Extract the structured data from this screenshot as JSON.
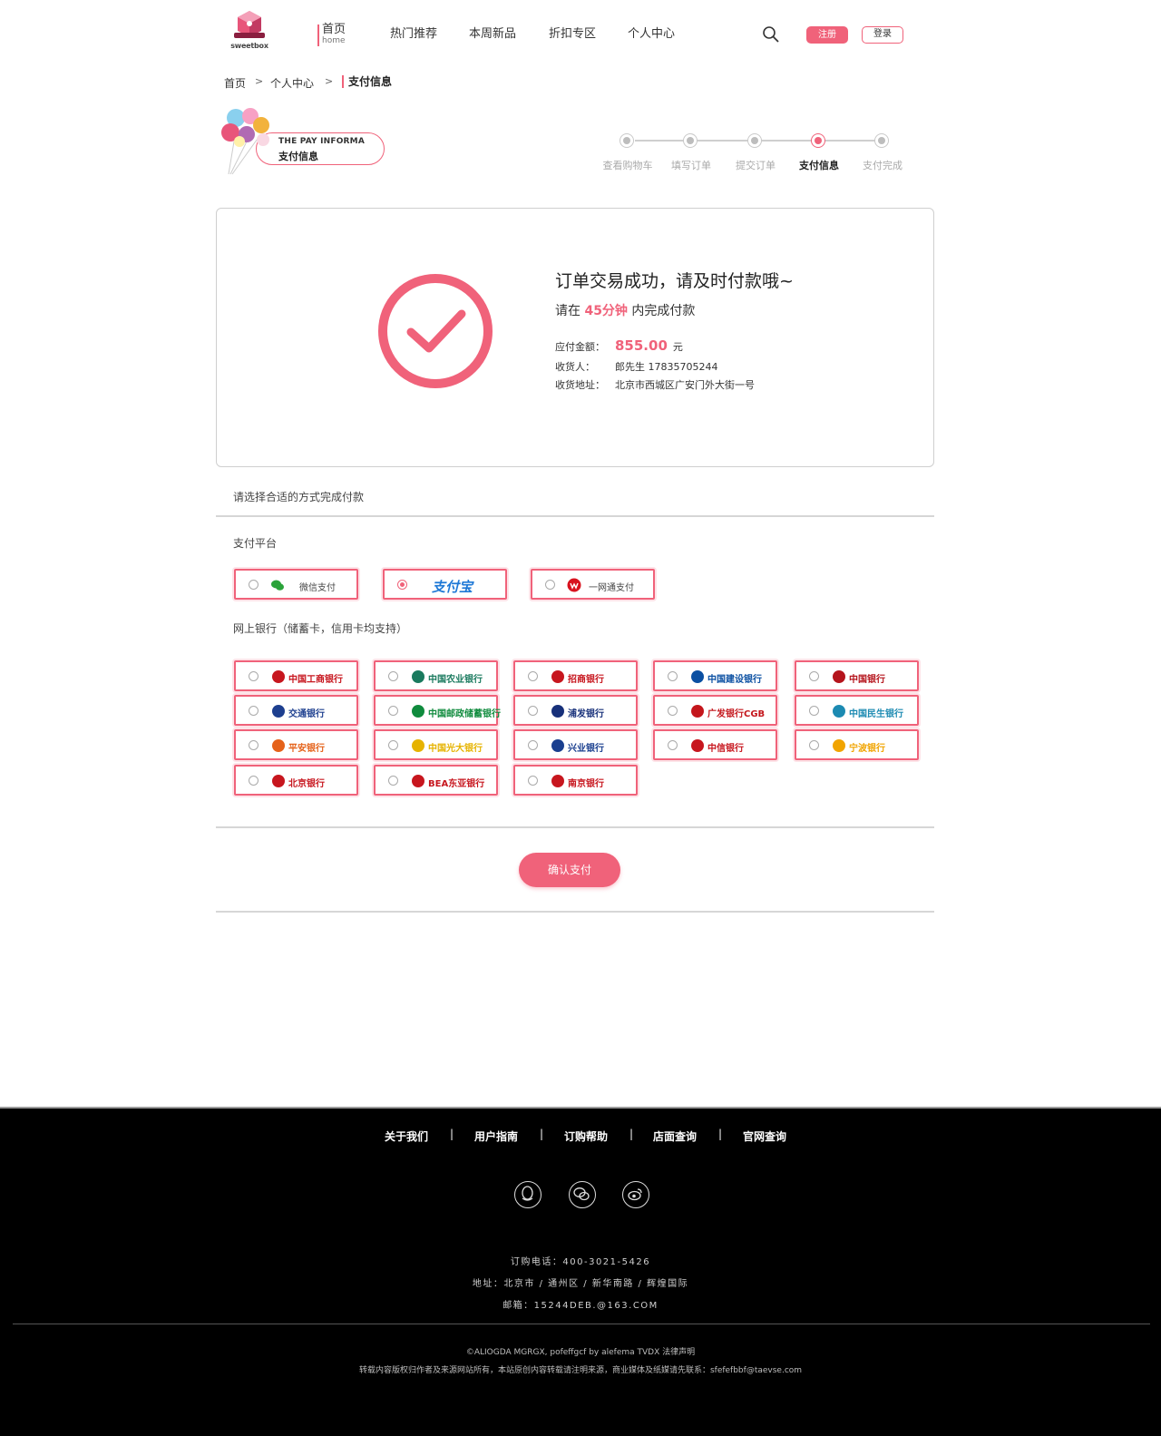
{
  "header": {
    "logo_text": "sweetbox",
    "nav": [
      {
        "label": "首页",
        "sub": "home"
      },
      {
        "label": "热门推荐"
      },
      {
        "label": "本周新品"
      },
      {
        "label": "折扣专区"
      },
      {
        "label": "个人中心"
      }
    ],
    "register_label": "注册",
    "login_label": "登录"
  },
  "breadcrumb": [
    "首页",
    "个人中心",
    "支付信息"
  ],
  "banner": {
    "en": "THE PAY INFORMA",
    "cn": "支付信息"
  },
  "steps": [
    {
      "label": "查看购物车",
      "active": false
    },
    {
      "label": "填写订单",
      "active": false
    },
    {
      "label": "提交订单",
      "active": false
    },
    {
      "label": "支付信息",
      "active": true
    },
    {
      "label": "支付完成",
      "active": false
    }
  ],
  "success": {
    "title": "订单交易成功，请及时付款哦~",
    "time_prefix": "请在",
    "time_value": "45分钟",
    "time_suffix": "内完成付款",
    "amount_label": "应付金额：",
    "amount_value": "855.00",
    "amount_unit": "元",
    "receiver_label": "收货人：",
    "receiver_value": "郎先生  17835705244",
    "address_label": "收货地址：",
    "address_value": "北京市西城区广安门外大街一号"
  },
  "payment": {
    "section_title": "请选择合适的方式完成付款",
    "platform_title": "支付平台",
    "platforms": [
      {
        "label": "微信支付",
        "icon": "wechat-icon",
        "selected": false
      },
      {
        "label": "支付宝",
        "icon": "alipay-logo",
        "selected": true
      },
      {
        "label": "一网通支付",
        "icon": "yiwangtong-icon",
        "selected": false
      }
    ],
    "bank_title": "网上银行（储蓄卡，信用卡均支持）",
    "banks": [
      {
        "label": "中国工商银行",
        "color": "#c7161e"
      },
      {
        "label": "中国农业银行",
        "color": "#1a7a5e"
      },
      {
        "label": "招商银行",
        "color": "#c7161e"
      },
      {
        "label": "中国建设银行",
        "color": "#0a4fa2"
      },
      {
        "label": "中国银行",
        "color": "#b5141c"
      },
      {
        "label": "交通银行",
        "color": "#1d3f8f"
      },
      {
        "label": "中国邮政储蓄银行",
        "color": "#0f8b3d"
      },
      {
        "label": "浦发银行",
        "color": "#17307a"
      },
      {
        "label": "广发银行CGB",
        "color": "#c4161c"
      },
      {
        "label": "中国民生银行",
        "color": "#1c8ab2"
      },
      {
        "label": "平安银行",
        "color": "#e5621a"
      },
      {
        "label": "中国光大银行",
        "color": "#e6b300"
      },
      {
        "label": "兴业银行",
        "color": "#1a3f8f"
      },
      {
        "label": "中信银行",
        "color": "#c7161e"
      },
      {
        "label": "宁波银行",
        "color": "#f1a400"
      },
      {
        "label": "北京银行",
        "color": "#c7161e"
      },
      {
        "label": "BEA东亚银行",
        "color": "#c7161e"
      },
      {
        "label": "南京银行",
        "color": "#c7161e"
      }
    ],
    "confirm_label": "确认支付"
  },
  "footer": {
    "links": [
      "关于我们",
      "用户指南",
      "订购帮助",
      "店面查询",
      "官网查询"
    ],
    "separator": "|",
    "social_icons": [
      "qq-icon",
      "wechat-icon",
      "weibo-icon"
    ],
    "phone": "订购电话：400-3021-5426",
    "address": "地址：北京市 / 通州区 / 新华南路 / 辉煌国际",
    "email": "邮箱：15244DEB.@163.COM",
    "copyright": "©ALIOGDA MGRGX, pofeffgcf by alefema TVDX 法律声明",
    "notice": "转载内容版权归作者及来源网站所有，本站原创内容转载请注明来源，商业媒体及纸媒请先联系：sfefefbbf@taevse.com"
  },
  "colors": {
    "accent": "#f0627a",
    "footer_bg": "#000000"
  }
}
